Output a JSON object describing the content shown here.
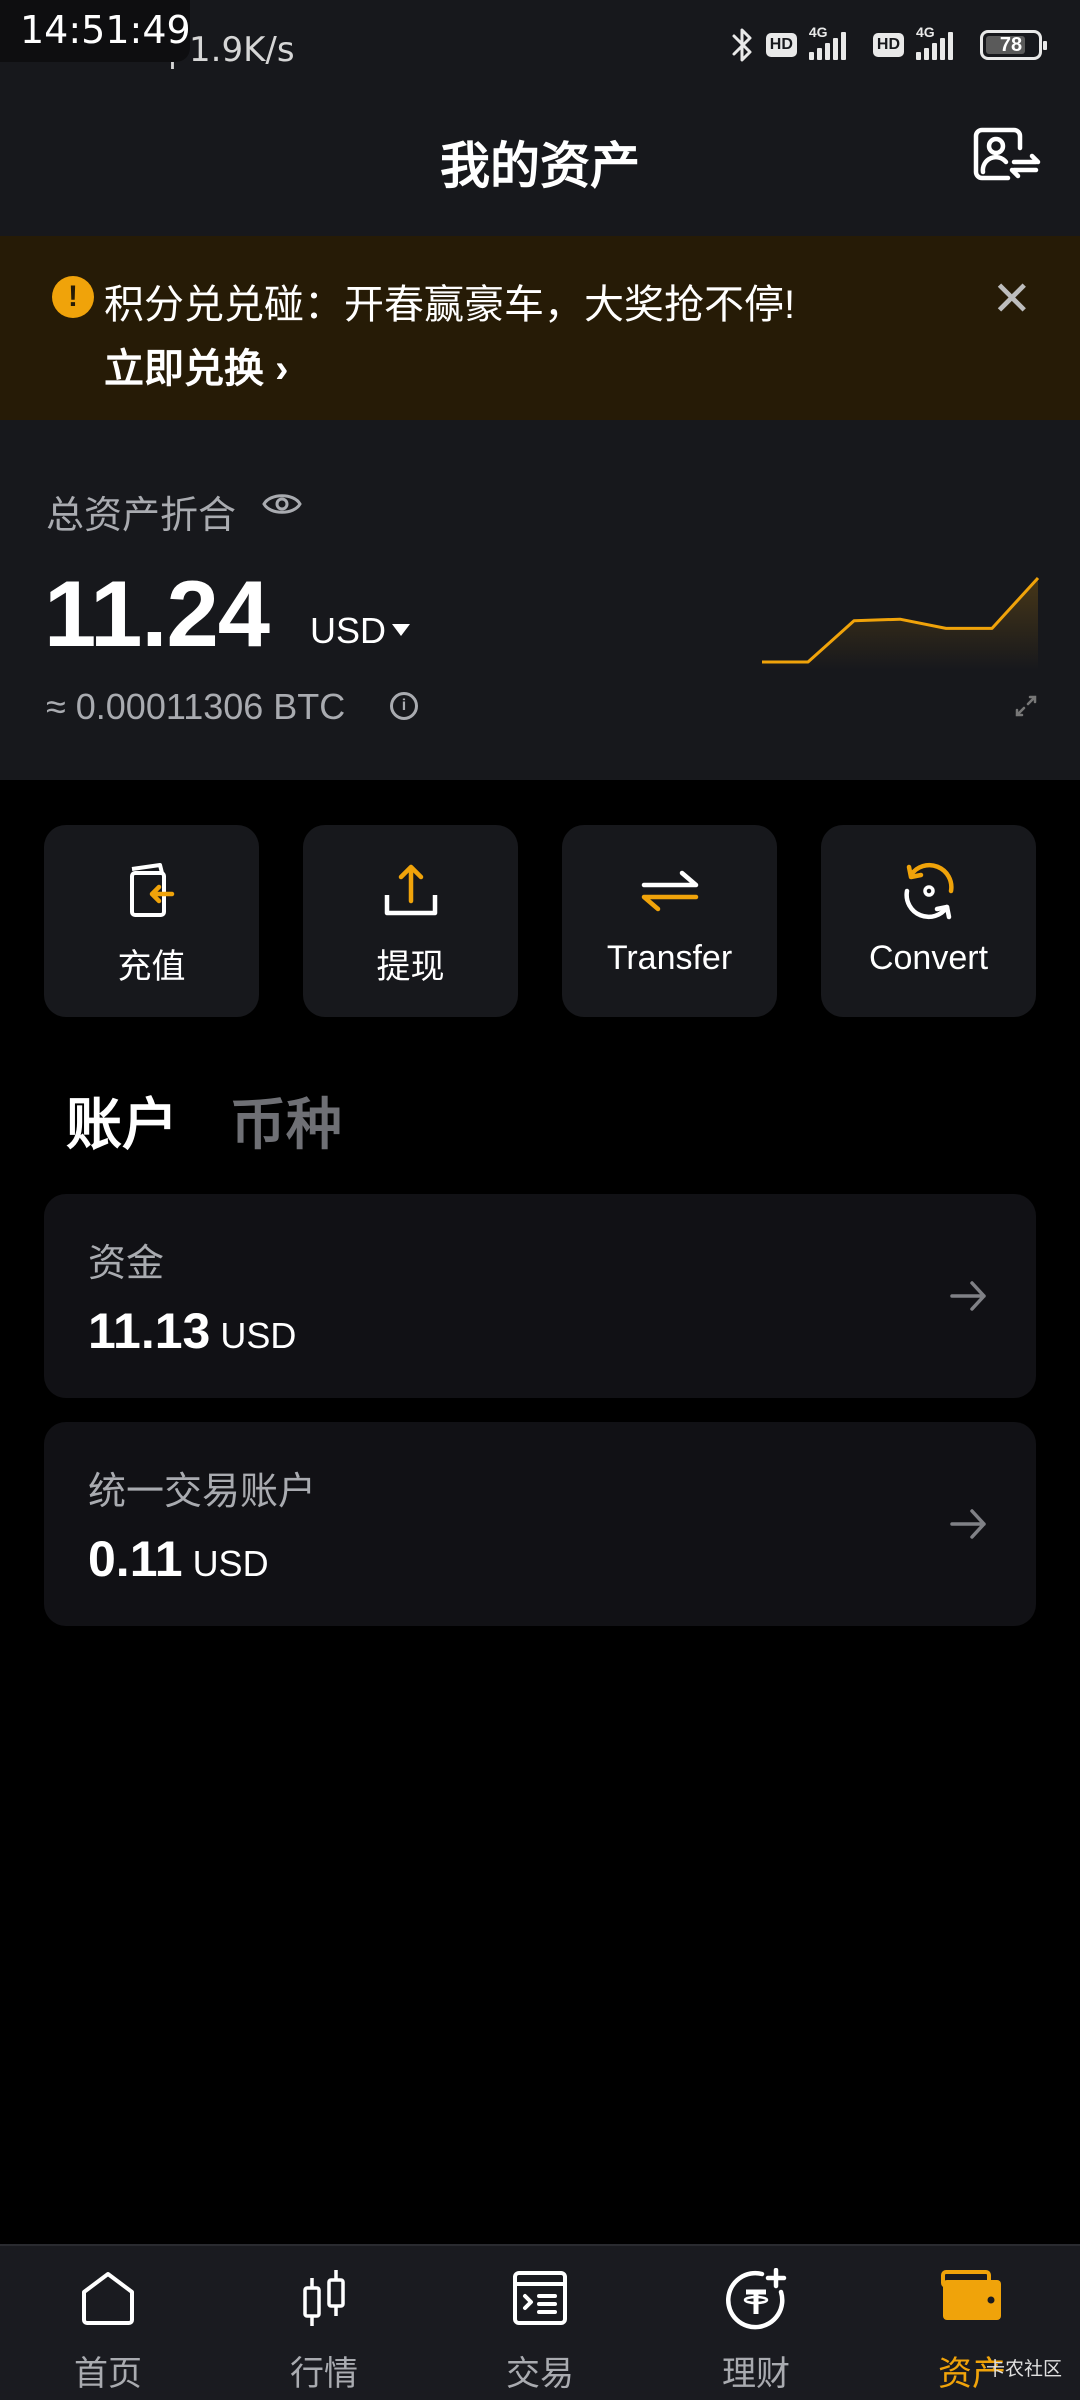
{
  "status_bar": {
    "overlay_clock": "14:51:49",
    "time_and_speed": "14:51 | 1.9K/s",
    "network_labels": [
      "HD",
      "4G",
      "HD",
      "4G"
    ],
    "battery": "78"
  },
  "header": {
    "title": "我的资产",
    "account_switch_icon": "account-switch-icon"
  },
  "banner": {
    "message": "积分兑兑碰：开春赢豪车，大奖抢不停!",
    "cta": "立即兑换 ›",
    "close": "✕",
    "accent": "#f0a30a"
  },
  "summary": {
    "label": "总资产折合",
    "amount": "11.24",
    "currency": "USD",
    "btc_equiv": "≈ 0.00011306 BTC",
    "info": "i",
    "trend": [
      0.0,
      0.0,
      0.49,
      0.51,
      0.4,
      0.4,
      1.0
    ]
  },
  "actions": [
    {
      "label": "充值",
      "icon": "deposit-icon"
    },
    {
      "label": "提现",
      "icon": "withdraw-icon"
    },
    {
      "label": "Transfer",
      "icon": "transfer-icon"
    },
    {
      "label": "Convert",
      "icon": "convert-icon"
    }
  ],
  "tabs": [
    {
      "label": "账户",
      "active": true
    },
    {
      "label": "币种",
      "active": false
    }
  ],
  "accounts": [
    {
      "name": "资金",
      "value": "11.13",
      "unit": "USD"
    },
    {
      "name": "统一交易账户",
      "value": "0.11",
      "unit": "USD"
    }
  ],
  "bottom_nav": [
    {
      "label": "首页",
      "icon": "home-icon",
      "active": false
    },
    {
      "label": "行情",
      "icon": "candlestick-icon",
      "active": false
    },
    {
      "label": "交易",
      "icon": "trade-icon",
      "active": false
    },
    {
      "label": "理财",
      "icon": "earn-icon",
      "active": false
    },
    {
      "label": "资产",
      "icon": "wallet-icon",
      "active": true
    }
  ],
  "watermark": "卡农社区"
}
